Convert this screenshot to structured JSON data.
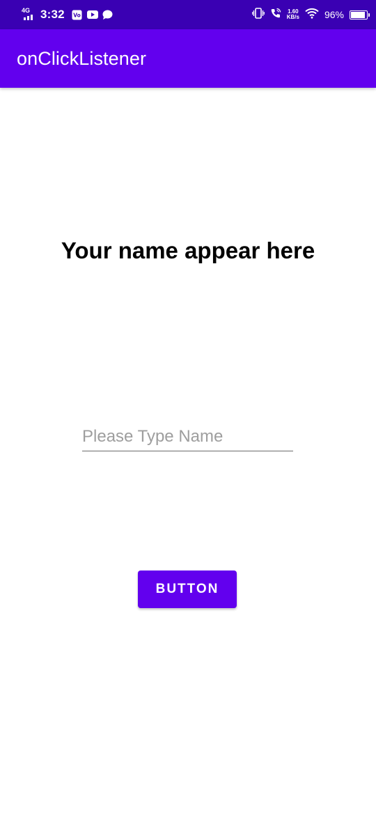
{
  "status_bar": {
    "network_type": "4G",
    "time": "3:32",
    "notification_icons": [
      "vpn-icon",
      "youtube-icon",
      "chat-icon"
    ],
    "right_icons": [
      "vibrate-icon",
      "wifi-calling-icon",
      "data-speed-icon",
      "wifi-icon",
      "battery-icon"
    ],
    "speed_value": "1.60",
    "speed_unit": "KB/s",
    "battery_percent": "96%",
    "battery_level": 0.96,
    "background_color": "#3a00b3"
  },
  "app_bar": {
    "title": "onClickListener",
    "background_color": "#6200ee"
  },
  "main": {
    "name_display_text": "Your name appear here",
    "name_input": {
      "value": "",
      "placeholder": "Please Type Name"
    },
    "button_label": "BUTTON",
    "accent_color": "#6200ee"
  }
}
